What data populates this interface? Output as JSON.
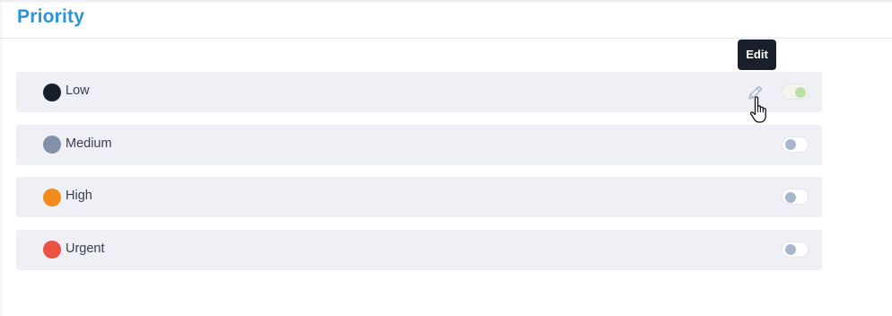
{
  "header": {
    "title": "Priority"
  },
  "priorities": [
    {
      "label": "Low",
      "color": "#16202b",
      "enabled": true
    },
    {
      "label": "Medium",
      "color": "#8291a8",
      "enabled": false
    },
    {
      "label": "High",
      "color": "#f28a1c",
      "enabled": false
    },
    {
      "label": "Urgent",
      "color": "#ec5244",
      "enabled": false
    }
  ],
  "tooltip": {
    "text": "Edit"
  },
  "icons": {
    "edit": "pencil-icon",
    "cursor": "hand-pointer-cursor-icon"
  },
  "colors": {
    "title": "#2a95d6",
    "row_background": "#eef0f5",
    "toggle_on_knob": "#b8dfa4",
    "toggle_off_knob": "#a7b5cd",
    "tooltip_background": "#1a202b"
  }
}
